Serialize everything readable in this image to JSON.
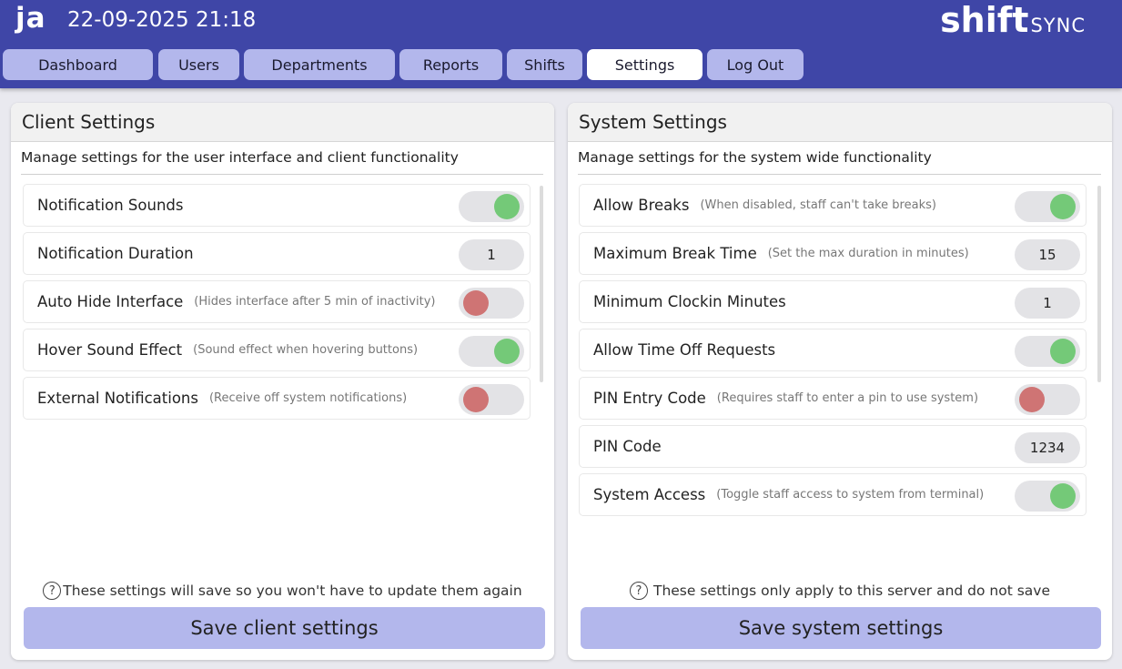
{
  "header": {
    "user_initials": "ja",
    "datetime": "22-09-2025 21:18",
    "brand_main": "shift",
    "brand_sub": "SYNC",
    "accent_color": "#3f46a7"
  },
  "nav": {
    "tabs": [
      {
        "label": "Dashboard",
        "active": false
      },
      {
        "label": "Users",
        "active": false
      },
      {
        "label": "Departments",
        "active": false
      },
      {
        "label": "Reports",
        "active": false
      },
      {
        "label": "Shifts",
        "active": false
      },
      {
        "label": "Settings",
        "active": true
      },
      {
        "label": "Log Out",
        "active": false
      }
    ]
  },
  "client": {
    "title": "Client Settings",
    "description": "Manage settings for the user interface and client functionality",
    "rows": [
      {
        "label": "Notification Sounds",
        "hint": "",
        "type": "toggle",
        "on": true
      },
      {
        "label": "Notification Duration",
        "hint": "",
        "type": "value",
        "value": "1"
      },
      {
        "label": "Auto Hide Interface",
        "hint": "(Hides interface after 5 min of inactivity)",
        "type": "toggle",
        "on": false
      },
      {
        "label": "Hover Sound Effect",
        "hint": "(Sound effect when hovering buttons)",
        "type": "toggle",
        "on": true
      },
      {
        "label": "External Notifications",
        "hint": "(Receive off system notifications)",
        "type": "toggle",
        "on": false
      }
    ],
    "note": "These settings will save so you won't have to update them again",
    "save_label": "Save client settings"
  },
  "system": {
    "title": "System Settings",
    "description": "Manage settings for the system wide functionality",
    "rows": [
      {
        "label": "Allow Breaks",
        "hint": "(When disabled, staff can't take breaks)",
        "type": "toggle",
        "on": true
      },
      {
        "label": "Maximum Break Time",
        "hint": "(Set the max duration in minutes)",
        "type": "value",
        "value": "15"
      },
      {
        "label": "Minimum Clockin Minutes",
        "hint": "",
        "type": "value",
        "value": "1"
      },
      {
        "label": "Allow Time Off Requests",
        "hint": "",
        "type": "toggle",
        "on": true
      },
      {
        "label": "PIN Entry Code",
        "hint": "(Requires staff to enter a pin to use system)",
        "type": "toggle",
        "on": false
      },
      {
        "label": "PIN Code",
        "hint": "",
        "type": "value",
        "value": "1234"
      },
      {
        "label": "System Access",
        "hint": "(Toggle staff access to system from terminal)",
        "type": "toggle",
        "on": true
      }
    ],
    "note": "These settings only apply to this server and do not save",
    "save_label": "Save system settings"
  },
  "colors": {
    "toggle_on": "#74c978",
    "toggle_off": "#cf7474",
    "button": "#b3b7ec"
  },
  "icons": {
    "help": "help-circle-icon"
  }
}
